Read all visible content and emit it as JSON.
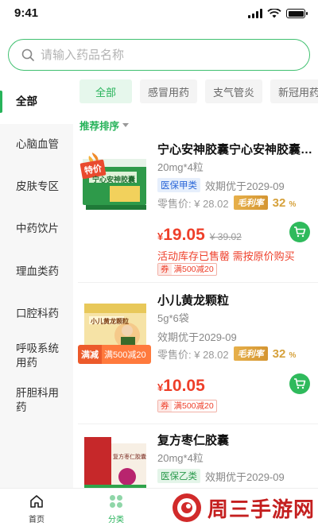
{
  "status": {
    "time": "9:41"
  },
  "search": {
    "placeholder": "请输入药品名称"
  },
  "sidebar": {
    "items": [
      {
        "label": "全部",
        "active": true
      },
      {
        "label": "心脑血管"
      },
      {
        "label": "皮肤专区"
      },
      {
        "label": "中药饮片"
      },
      {
        "label": "理血类药"
      },
      {
        "label": "口腔科药"
      },
      {
        "label": "呼吸系统用药"
      },
      {
        "label": "肝胆科用药"
      }
    ]
  },
  "tabs": [
    "全部",
    "感冒用药",
    "支气管炎",
    "新冠用药"
  ],
  "sort": {
    "label": "推荐排序"
  },
  "products": [
    {
      "name": "宁心安神胶囊宁心安神胶囊宁心安神胶囊",
      "spec": "20mg*4粒",
      "insurance": "医保甲类",
      "validity": "效期优于2029-09",
      "retail": "零售价: ¥ 28.02",
      "margin_label": "毛利率",
      "margin_value": "32",
      "margin_unit": "%",
      "price_currency": "¥",
      "price": "19.05",
      "original_price": "¥ 39.02",
      "warning": "活动库存已售罄 需按原价购买",
      "coupon_tag": "券",
      "coupon_text": "满500减20",
      "promo_flag": "特价",
      "box_text": "宁心安神胶囊"
    },
    {
      "name": "小儿黄龙颗粒",
      "spec": "5g*6袋",
      "validity": "效期优于2029-09",
      "retail": "零售价: ¥ 28.02",
      "margin_label": "毛利率",
      "margin_value": "32",
      "margin_unit": "%",
      "price_currency": "¥",
      "price": "10.05",
      "coupon_tag": "券",
      "coupon_text": "满500减20",
      "badge_left": "满减",
      "badge_right": "满500减20",
      "box_text": "小儿黄龙颗粒"
    },
    {
      "name": "复方枣仁胶囊",
      "spec": "20mg*4粒",
      "insurance": "医保乙类",
      "validity": "效期优于2029-09",
      "box_text": "复方枣仁胶囊"
    }
  ],
  "tabbar": {
    "items": [
      {
        "label": "首页",
        "icon": "home-icon"
      },
      {
        "label": "分类",
        "icon": "category-icon",
        "active": true
      }
    ]
  },
  "watermark": {
    "text": "周三手游网"
  },
  "colors": {
    "accent": "#27b35a",
    "price": "#ee3f2a",
    "margin": "#d6a13b",
    "insurance": "#2a66d8"
  }
}
